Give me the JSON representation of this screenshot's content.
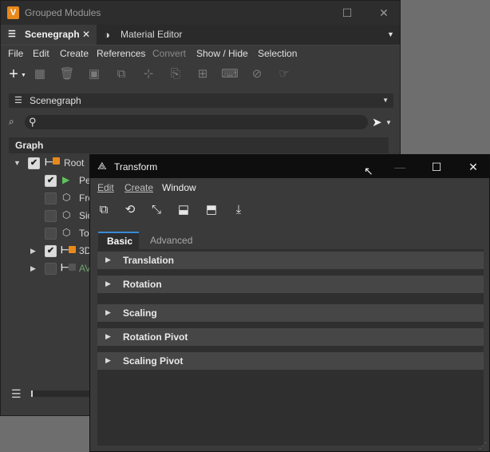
{
  "main_window": {
    "title": "Grouped Modules",
    "logo_letter": "V",
    "tabs": [
      {
        "label": "Scenegraph",
        "close": "✕"
      },
      {
        "label": "Material Editor"
      }
    ],
    "menu": [
      "File",
      "Edit",
      "Create",
      "References",
      "Convert",
      "Show / Hide",
      "Selection"
    ],
    "scene_selector": "Scenegraph",
    "search_placeholder": "",
    "section_label": "Graph",
    "tree": [
      {
        "label": "Root",
        "checked": true,
        "icon": "group-icon"
      },
      {
        "label": "Pe",
        "checked": true,
        "icon": "camera-icon"
      },
      {
        "label": "Fro",
        "checked": false,
        "icon": "cube-icon"
      },
      {
        "label": "Sic",
        "checked": false,
        "icon": "cube-icon"
      },
      {
        "label": "To",
        "checked": false,
        "icon": "cube-icon"
      },
      {
        "label": "3D",
        "checked": true,
        "icon": "group-icon"
      },
      {
        "label": "AV",
        "checked": false,
        "icon": "group-icon"
      }
    ]
  },
  "transform_window": {
    "title": "Transform",
    "menu": [
      "Edit",
      "Create",
      "Window"
    ],
    "subtabs": [
      "Basic",
      "Advanced"
    ],
    "groups": [
      "Translation",
      "Rotation",
      "Scaling",
      "Rotation Pivot",
      "Scaling Pivot"
    ]
  },
  "colors": {
    "accent": "#e8891c",
    "tab_underline": "#3a8ad6"
  }
}
